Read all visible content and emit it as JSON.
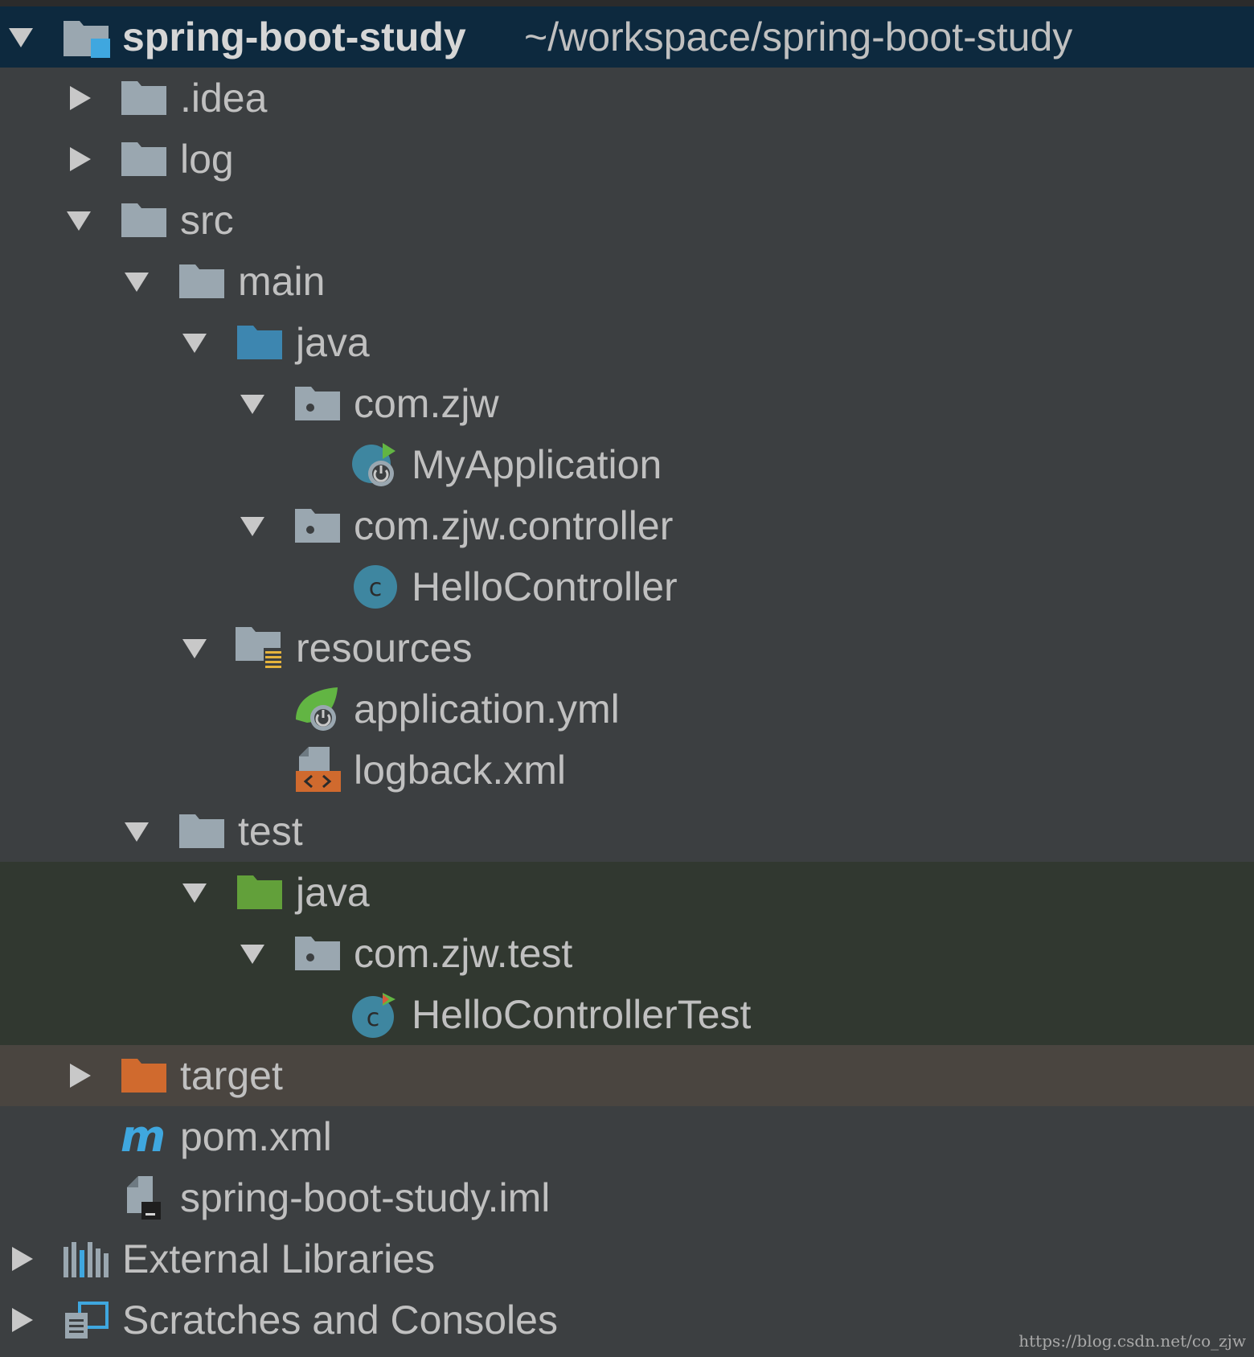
{
  "project": {
    "name": "spring-boot-study",
    "path": "~/workspace/spring-boot-study"
  },
  "nodes": {
    "idea": ".idea",
    "log": "log",
    "src": "src",
    "main": "main",
    "main_java": "java",
    "pkg_main": "com.zjw",
    "my_application": "MyApplication",
    "pkg_controller": "com.zjw.controller",
    "hello_controller": "HelloController",
    "resources": "resources",
    "application_yml": "application.yml",
    "logback_xml": "logback.xml",
    "test": "test",
    "test_java": "java",
    "pkg_test": "com.zjw.test",
    "hello_controller_test": "HelloControllerTest",
    "target": "target",
    "pom_xml": "pom.xml",
    "iml_file": "spring-boot-study.iml",
    "external_libraries": "External Libraries",
    "scratches": "Scratches and Consoles"
  },
  "watermark": "https://blog.csdn.net/co_zjw",
  "colors": {
    "background": "#3c3f41",
    "root_selection": "#0d293e",
    "test_band": "#313830",
    "excluded_band": "#4a4540",
    "folder_gray": "#9aa7b0",
    "source_folder_blue": "#3d86b0",
    "test_folder_green": "#62a03a",
    "excluded_folder_orange": "#d06a2e",
    "class_icon_blue": "#3e86a0"
  }
}
